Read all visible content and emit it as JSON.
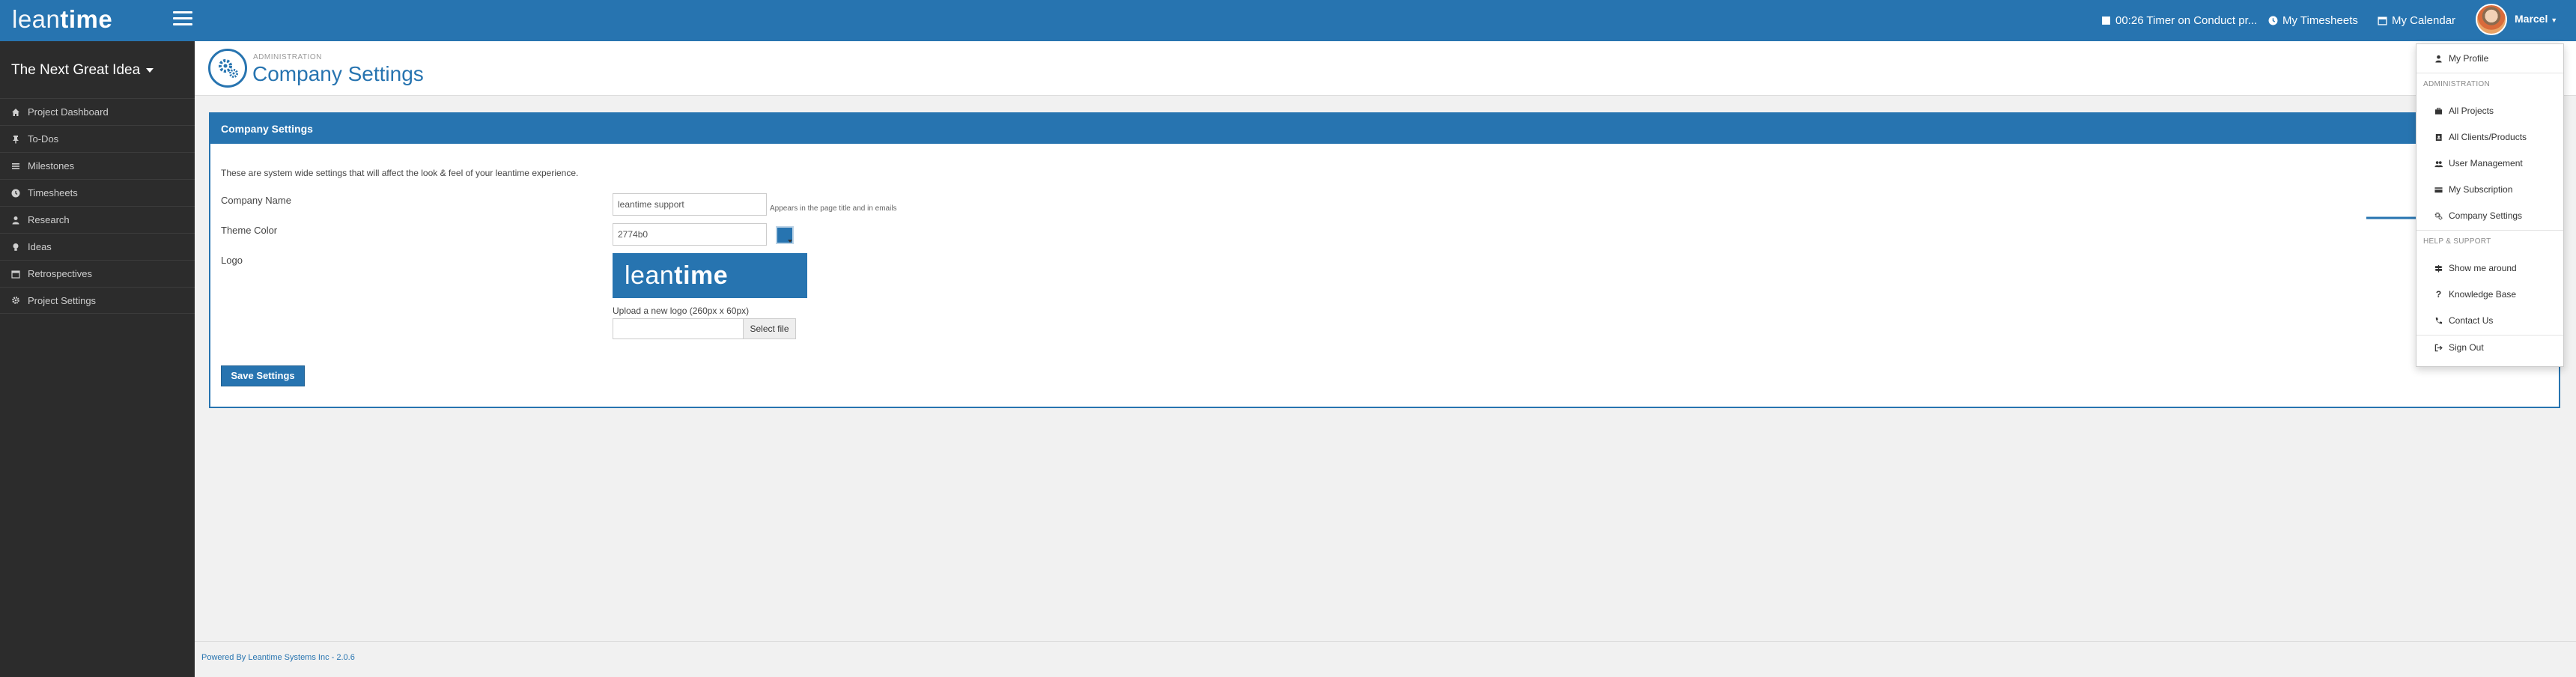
{
  "header": {
    "logo_left": "lean",
    "logo_right": "time",
    "timer": "00:26 Timer on Conduct pr...",
    "timesheets": "My Timesheets",
    "calendar": "My Calendar",
    "user": "Marcel"
  },
  "sidebar": {
    "project": "The Next Great Idea",
    "items": [
      {
        "label": "Project Dashboard",
        "icon": "home-icon"
      },
      {
        "label": "To-Dos",
        "icon": "pin-icon"
      },
      {
        "label": "Milestones",
        "icon": "list-icon"
      },
      {
        "label": "Timesheets",
        "icon": "clock-icon"
      },
      {
        "label": "Research",
        "icon": "user-icon"
      },
      {
        "label": "Ideas",
        "icon": "bulb-icon"
      },
      {
        "label": "Retrospectives",
        "icon": "calendar-icon"
      },
      {
        "label": "Project Settings",
        "icon": "gear-icon"
      }
    ]
  },
  "page": {
    "section": "ADMINISTRATION",
    "title": "Company Settings"
  },
  "panel": {
    "title": "Company Settings",
    "intro": "These are system wide settings that will affect the look & feel of your leantime experience.",
    "company_name_label": "Company Name",
    "company_name_value": "leantime support",
    "company_name_help": "Appears in the page title and in emails",
    "theme_color_label": "Theme Color",
    "theme_color_value": "2774b0",
    "theme_color_hex": "#2774b0",
    "logo_label": "Logo",
    "logo_left": "lean",
    "logo_right": "time",
    "upload_label": "Upload a new logo (260px x 60px)",
    "select_file": "Select file",
    "save": "Save Settings"
  },
  "footer": {
    "text": "Powered By Leantime Systems Inc - 2.0.6"
  },
  "dropdown": {
    "my_profile": "My Profile",
    "admin_head": "ADMINISTRATION",
    "all_projects": "All Projects",
    "all_clients": "All Clients/Products",
    "user_mgmt": "User Management",
    "my_subscription": "My Subscription",
    "company_settings": "Company Settings",
    "help_head": "HELP & SUPPORT",
    "show_around": "Show me around",
    "knowledge_base": "Knowledge Base",
    "contact_us": "Contact Us",
    "sign_out": "Sign Out"
  }
}
